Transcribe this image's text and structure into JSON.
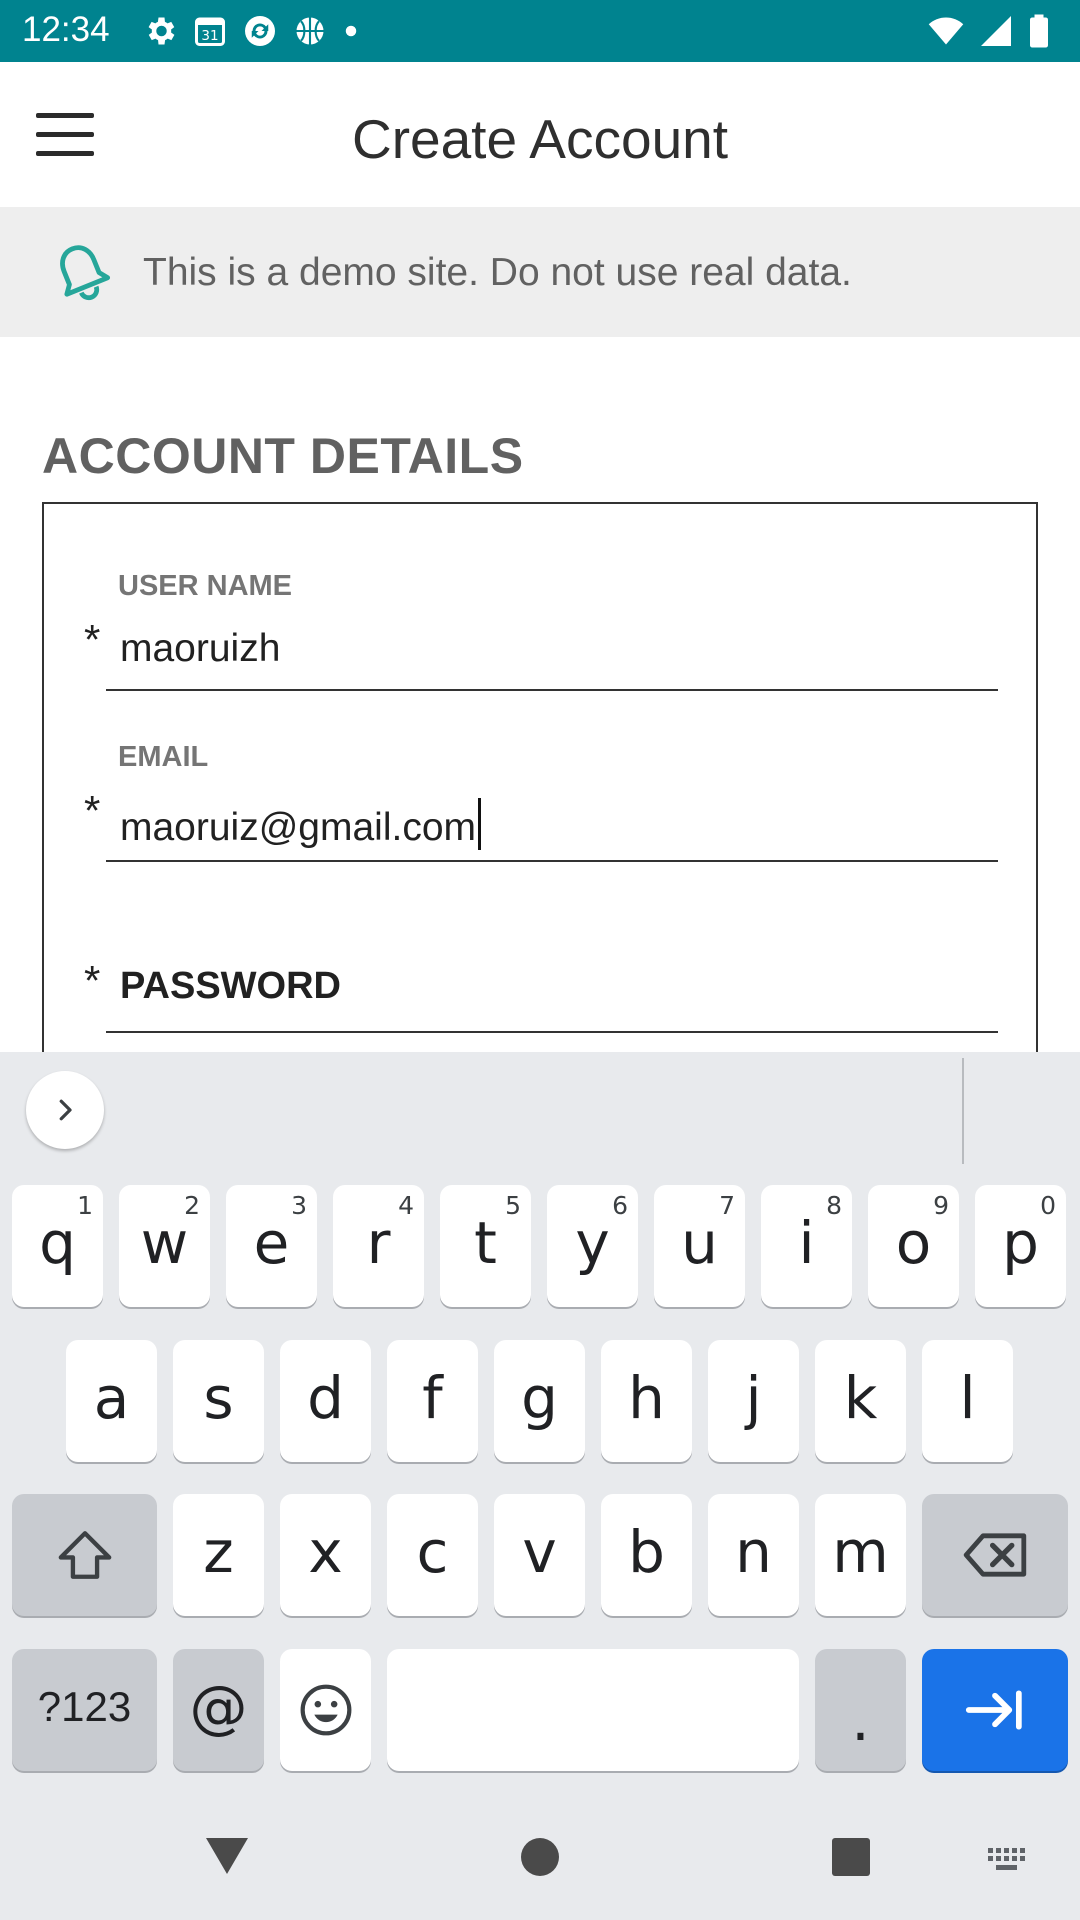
{
  "status_bar": {
    "time": "12:34",
    "calendar_day": "31",
    "color": "#00838f"
  },
  "app_bar": {
    "title": "Create Account",
    "menu_icon": "hamburger-menu-icon"
  },
  "banner": {
    "icon": "bell-icon",
    "text": "This is a demo site. Do not use real data.",
    "icon_color": "#26a69a"
  },
  "form": {
    "section_title": "ACCOUNT DETAILS",
    "fields": {
      "username": {
        "label": "USER NAME",
        "value": "maoruizh",
        "required_mark": "*"
      },
      "email": {
        "label": "EMAIL",
        "value": "maoruiz@gmail.com",
        "required_mark": "*"
      },
      "password": {
        "placeholder": "PASSWORD",
        "required_mark": "*"
      }
    }
  },
  "keyboard": {
    "row1": [
      {
        "key": "q",
        "hint": "1"
      },
      {
        "key": "w",
        "hint": "2"
      },
      {
        "key": "e",
        "hint": "3"
      },
      {
        "key": "r",
        "hint": "4"
      },
      {
        "key": "t",
        "hint": "5"
      },
      {
        "key": "y",
        "hint": "6"
      },
      {
        "key": "u",
        "hint": "7"
      },
      {
        "key": "i",
        "hint": "8"
      },
      {
        "key": "o",
        "hint": "9"
      },
      {
        "key": "p",
        "hint": "0"
      }
    ],
    "row2": [
      "a",
      "s",
      "d",
      "f",
      "g",
      "h",
      "j",
      "k",
      "l"
    ],
    "row3": [
      "z",
      "x",
      "c",
      "v",
      "b",
      "n",
      "m"
    ],
    "bottom": {
      "symbols_label": "?123",
      "at_label": "@",
      "period_label": "."
    },
    "icons": {
      "expand": "chevron-right-icon",
      "shift": "shift-icon",
      "backspace": "backspace-icon",
      "emoji": "emoji-icon",
      "enter": "next-arrow-icon"
    },
    "enter_color": "#1a73e8"
  }
}
